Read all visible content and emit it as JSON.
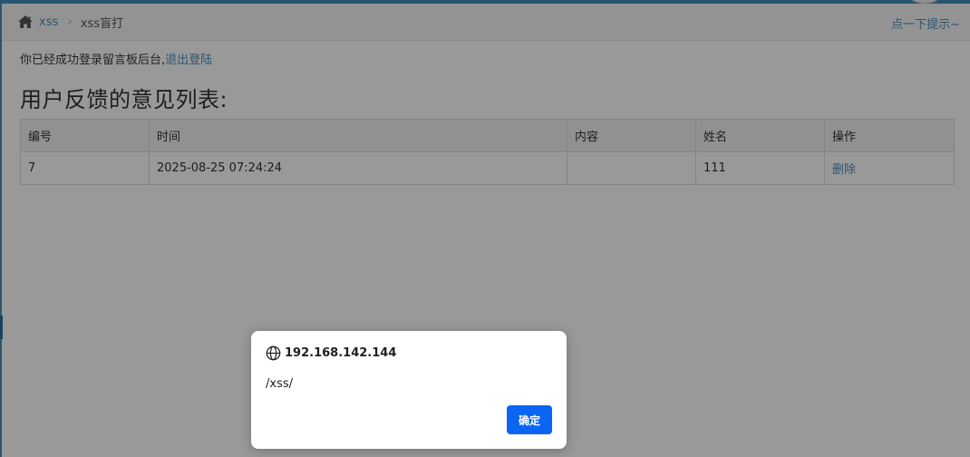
{
  "breadcrumb": {
    "home": "xss",
    "separator": "›",
    "current": "xss盲打"
  },
  "hint_link": "点一下提示~",
  "login_status": {
    "text": "你已经成功登录留言板后台,",
    "logout_label": "退出登陆"
  },
  "page_title": "用户反馈的意见列表:",
  "table": {
    "headers": [
      "编号",
      "时间",
      "内容",
      "姓名",
      "操作"
    ],
    "rows": [
      {
        "id": "7",
        "time": "2025-08-25 07:24:24",
        "content": "",
        "name": "111",
        "action": "删除"
      }
    ]
  },
  "alert_dialog": {
    "origin": "192.168.142.144",
    "message": "/xss/",
    "ok_label": "确定"
  },
  "colors": {
    "accent": "#438eb9",
    "link": "#4c8fbd",
    "dialog_button": "#0b65f3"
  },
  "icons": {
    "home": "home-icon",
    "globe": "globe-icon"
  }
}
